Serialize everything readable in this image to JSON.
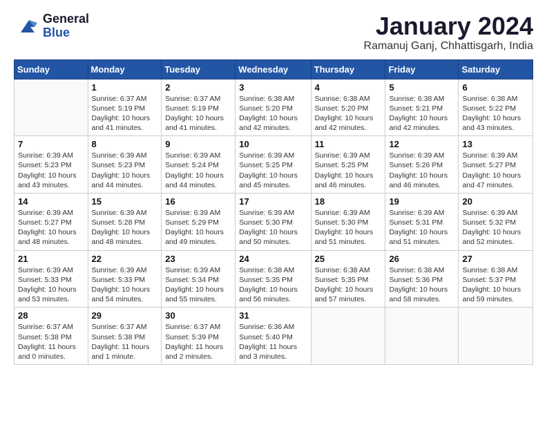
{
  "header": {
    "logo_general": "General",
    "logo_blue": "Blue",
    "month_title": "January 2024",
    "location": "Ramanuj Ganj, Chhattisgarh, India"
  },
  "days_of_week": [
    "Sunday",
    "Monday",
    "Tuesday",
    "Wednesday",
    "Thursday",
    "Friday",
    "Saturday"
  ],
  "weeks": [
    [
      {
        "day": "",
        "sunrise": "",
        "sunset": "",
        "daylight": ""
      },
      {
        "day": "1",
        "sunrise": "Sunrise: 6:37 AM",
        "sunset": "Sunset: 5:19 PM",
        "daylight": "Daylight: 10 hours and 41 minutes."
      },
      {
        "day": "2",
        "sunrise": "Sunrise: 6:37 AM",
        "sunset": "Sunset: 5:19 PM",
        "daylight": "Daylight: 10 hours and 41 minutes."
      },
      {
        "day": "3",
        "sunrise": "Sunrise: 6:38 AM",
        "sunset": "Sunset: 5:20 PM",
        "daylight": "Daylight: 10 hours and 42 minutes."
      },
      {
        "day": "4",
        "sunrise": "Sunrise: 6:38 AM",
        "sunset": "Sunset: 5:20 PM",
        "daylight": "Daylight: 10 hours and 42 minutes."
      },
      {
        "day": "5",
        "sunrise": "Sunrise: 6:38 AM",
        "sunset": "Sunset: 5:21 PM",
        "daylight": "Daylight: 10 hours and 42 minutes."
      },
      {
        "day": "6",
        "sunrise": "Sunrise: 6:38 AM",
        "sunset": "Sunset: 5:22 PM",
        "daylight": "Daylight: 10 hours and 43 minutes."
      }
    ],
    [
      {
        "day": "7",
        "sunrise": "Sunrise: 6:39 AM",
        "sunset": "Sunset: 5:23 PM",
        "daylight": "Daylight: 10 hours and 43 minutes."
      },
      {
        "day": "8",
        "sunrise": "Sunrise: 6:39 AM",
        "sunset": "Sunset: 5:23 PM",
        "daylight": "Daylight: 10 hours and 44 minutes."
      },
      {
        "day": "9",
        "sunrise": "Sunrise: 6:39 AM",
        "sunset": "Sunset: 5:24 PM",
        "daylight": "Daylight: 10 hours and 44 minutes."
      },
      {
        "day": "10",
        "sunrise": "Sunrise: 6:39 AM",
        "sunset": "Sunset: 5:25 PM",
        "daylight": "Daylight: 10 hours and 45 minutes."
      },
      {
        "day": "11",
        "sunrise": "Sunrise: 6:39 AM",
        "sunset": "Sunset: 5:25 PM",
        "daylight": "Daylight: 10 hours and 46 minutes."
      },
      {
        "day": "12",
        "sunrise": "Sunrise: 6:39 AM",
        "sunset": "Sunset: 5:26 PM",
        "daylight": "Daylight: 10 hours and 46 minutes."
      },
      {
        "day": "13",
        "sunrise": "Sunrise: 6:39 AM",
        "sunset": "Sunset: 5:27 PM",
        "daylight": "Daylight: 10 hours and 47 minutes."
      }
    ],
    [
      {
        "day": "14",
        "sunrise": "Sunrise: 6:39 AM",
        "sunset": "Sunset: 5:27 PM",
        "daylight": "Daylight: 10 hours and 48 minutes."
      },
      {
        "day": "15",
        "sunrise": "Sunrise: 6:39 AM",
        "sunset": "Sunset: 5:28 PM",
        "daylight": "Daylight: 10 hours and 48 minutes."
      },
      {
        "day": "16",
        "sunrise": "Sunrise: 6:39 AM",
        "sunset": "Sunset: 5:29 PM",
        "daylight": "Daylight: 10 hours and 49 minutes."
      },
      {
        "day": "17",
        "sunrise": "Sunrise: 6:39 AM",
        "sunset": "Sunset: 5:30 PM",
        "daylight": "Daylight: 10 hours and 50 minutes."
      },
      {
        "day": "18",
        "sunrise": "Sunrise: 6:39 AM",
        "sunset": "Sunset: 5:30 PM",
        "daylight": "Daylight: 10 hours and 51 minutes."
      },
      {
        "day": "19",
        "sunrise": "Sunrise: 6:39 AM",
        "sunset": "Sunset: 5:31 PM",
        "daylight": "Daylight: 10 hours and 51 minutes."
      },
      {
        "day": "20",
        "sunrise": "Sunrise: 6:39 AM",
        "sunset": "Sunset: 5:32 PM",
        "daylight": "Daylight: 10 hours and 52 minutes."
      }
    ],
    [
      {
        "day": "21",
        "sunrise": "Sunrise: 6:39 AM",
        "sunset": "Sunset: 5:33 PM",
        "daylight": "Daylight: 10 hours and 53 minutes."
      },
      {
        "day": "22",
        "sunrise": "Sunrise: 6:39 AM",
        "sunset": "Sunset: 5:33 PM",
        "daylight": "Daylight: 10 hours and 54 minutes."
      },
      {
        "day": "23",
        "sunrise": "Sunrise: 6:39 AM",
        "sunset": "Sunset: 5:34 PM",
        "daylight": "Daylight: 10 hours and 55 minutes."
      },
      {
        "day": "24",
        "sunrise": "Sunrise: 6:38 AM",
        "sunset": "Sunset: 5:35 PM",
        "daylight": "Daylight: 10 hours and 56 minutes."
      },
      {
        "day": "25",
        "sunrise": "Sunrise: 6:38 AM",
        "sunset": "Sunset: 5:35 PM",
        "daylight": "Daylight: 10 hours and 57 minutes."
      },
      {
        "day": "26",
        "sunrise": "Sunrise: 6:38 AM",
        "sunset": "Sunset: 5:36 PM",
        "daylight": "Daylight: 10 hours and 58 minutes."
      },
      {
        "day": "27",
        "sunrise": "Sunrise: 6:38 AM",
        "sunset": "Sunset: 5:37 PM",
        "daylight": "Daylight: 10 hours and 59 minutes."
      }
    ],
    [
      {
        "day": "28",
        "sunrise": "Sunrise: 6:37 AM",
        "sunset": "Sunset: 5:38 PM",
        "daylight": "Daylight: 11 hours and 0 minutes."
      },
      {
        "day": "29",
        "sunrise": "Sunrise: 6:37 AM",
        "sunset": "Sunset: 5:38 PM",
        "daylight": "Daylight: 11 hours and 1 minute."
      },
      {
        "day": "30",
        "sunrise": "Sunrise: 6:37 AM",
        "sunset": "Sunset: 5:39 PM",
        "daylight": "Daylight: 11 hours and 2 minutes."
      },
      {
        "day": "31",
        "sunrise": "Sunrise: 6:36 AM",
        "sunset": "Sunset: 5:40 PM",
        "daylight": "Daylight: 11 hours and 3 minutes."
      },
      {
        "day": "",
        "sunrise": "",
        "sunset": "",
        "daylight": ""
      },
      {
        "day": "",
        "sunrise": "",
        "sunset": "",
        "daylight": ""
      },
      {
        "day": "",
        "sunrise": "",
        "sunset": "",
        "daylight": ""
      }
    ]
  ]
}
